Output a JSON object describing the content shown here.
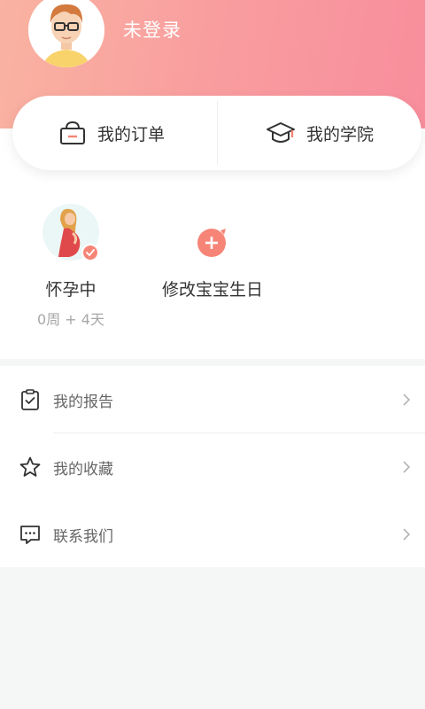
{
  "header": {
    "login_status": "未登录"
  },
  "quick_actions": {
    "orders_label": "我的订单",
    "academy_label": "我的学院"
  },
  "status": {
    "pregnancy_title": "怀孕中",
    "pregnancy_sub": "0周 + 4天",
    "edit_birthday_label": "修改宝宝生日"
  },
  "menu": {
    "items": [
      {
        "label": "我的报告",
        "icon": "clipboard-check-icon"
      },
      {
        "label": "我的收藏",
        "icon": "star-icon"
      },
      {
        "label": "联系我们",
        "icon": "chat-icon"
      }
    ]
  },
  "colors": {
    "header_gradient_start": "#f9b3a1",
    "header_gradient_end": "#f88e9c",
    "accent": "#f68577"
  }
}
